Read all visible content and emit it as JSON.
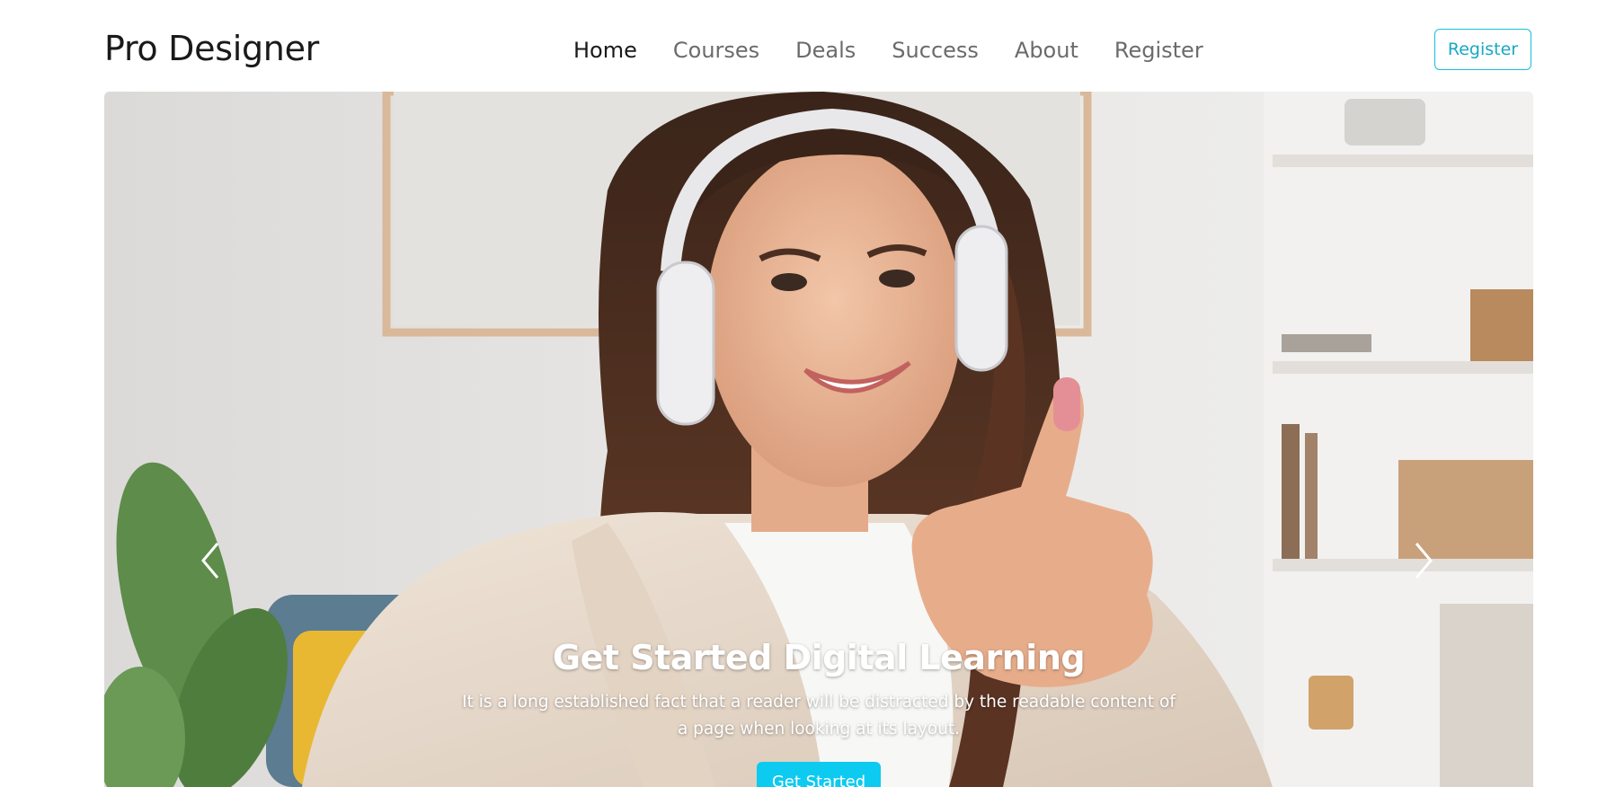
{
  "brand": {
    "name": "Pro Designer"
  },
  "nav": {
    "items": [
      {
        "label": "Home",
        "active": true
      },
      {
        "label": "Courses",
        "active": false
      },
      {
        "label": "Deals",
        "active": false
      },
      {
        "label": "Success",
        "active": false
      },
      {
        "label": "About",
        "active": false
      },
      {
        "label": "Register",
        "active": false
      }
    ],
    "register_button": "Register"
  },
  "hero": {
    "title": "Get Started Digital Learning",
    "text": "It is a long established fact that a reader will be distracted by the readable content of a page when looking at its layout.",
    "cta_label": "Get Started",
    "prev_icon": "chevron-left-icon",
    "next_icon": "chevron-right-icon",
    "image_subject": "smiling woman with headphones giving thumbs up"
  },
  "colors": {
    "accent": "#0dcaf0",
    "register_border": "#17c0d6",
    "text_dark": "#1a1a1a",
    "text_muted": "#6b6b6b"
  }
}
